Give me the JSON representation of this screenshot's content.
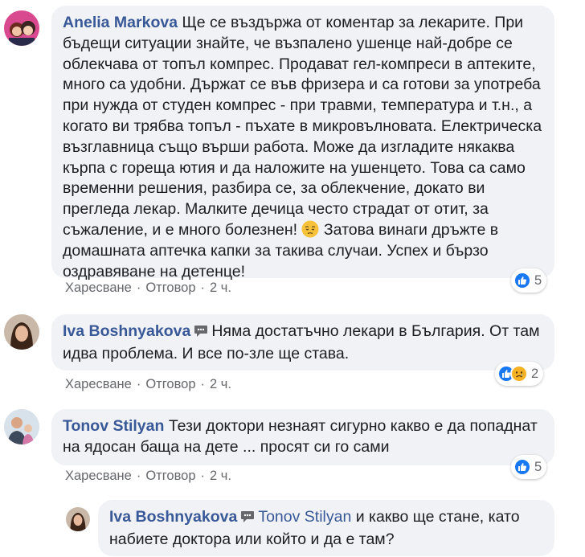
{
  "comments": [
    {
      "author": "Anelia Markova",
      "text_before_emoji": "Ще се въздържа от коментар за лекарите. При бъдещи ситуации знайте, че възпалено ушенце най-добре се облекчава от топъл компрес. Продават гел-компреси в аптеките, много са удобни. Държат се във фризера и са готови за употреба при нужда от студен компрес - при травми, температура и т.н., а когато ви трябва топъл - пъхате в микровълновата. Електрическа възглавница също върши работа. Може да изгладите някаква кърпа с гореща ютия и да наложите на ушенцето. Това са само временни решения, разбира се, за облекчение, докато ви прегледа лекар. Малките дечица често страдат от отит, за съжаление, и е много болезнен!",
      "emoji": "pensive-face-icon",
      "text_after_emoji": " Затова винаги дръжте в домашната аптечка капки за такива случаи. Успех и бързо оздравяване на детенце!",
      "like_label": "Харесване",
      "reply_label": "Отговор",
      "time": "2 ч.",
      "reaction_count": "5",
      "reactions": [
        "like-icon"
      ]
    },
    {
      "author": "Iva Boshnyakova",
      "author_badge": "conversation-starter-icon",
      "text": "Няма достатъчно лекари в България. От там идва проблема. И все по-зле ще става.",
      "like_label": "Харесване",
      "reply_label": "Отговор",
      "time": "2 ч.",
      "reaction_count": "2",
      "reactions": [
        "like-icon",
        "sad-icon"
      ]
    },
    {
      "author": "Tonov Stilyan",
      "text": "Тези доктори незнаят сигурно какво е да попаднат на ядосан баща на дете ... просят си го сами",
      "like_label": "Харесване",
      "reply_label": "Отговор",
      "time": "2 ч.",
      "reaction_count": "5",
      "reactions": [
        "like-icon"
      ]
    }
  ],
  "reply": {
    "author": "Iva Boshnyakova",
    "author_badge": "conversation-starter-icon",
    "mention": "Tonov Stilyan",
    "text": " и какво ще стане, като набиете доктора или който и да е там?"
  },
  "separator": "·",
  "colors": {
    "author": "#385898",
    "bubble": "#f0f2f5",
    "meta": "#65676b",
    "like": "#1877f2",
    "sad": "#f7b125"
  }
}
